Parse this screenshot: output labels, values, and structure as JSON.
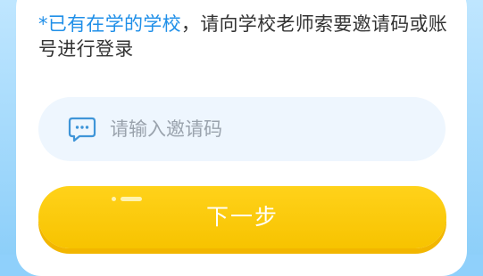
{
  "notice": {
    "highlight": "*已有在学的学校",
    "rest": "，请向学校老师索要邀请码或账号进行登录"
  },
  "invite_code": {
    "placeholder": "请输入邀请码",
    "value": "",
    "icon": "chat-bubble-icon"
  },
  "next_button": {
    "label": "下一步"
  },
  "colors": {
    "accent_blue": "#1f8fe8",
    "button_yellow": "#ffd21a",
    "input_bg": "#eef6fe",
    "page_bg": "#8fd0fb"
  }
}
